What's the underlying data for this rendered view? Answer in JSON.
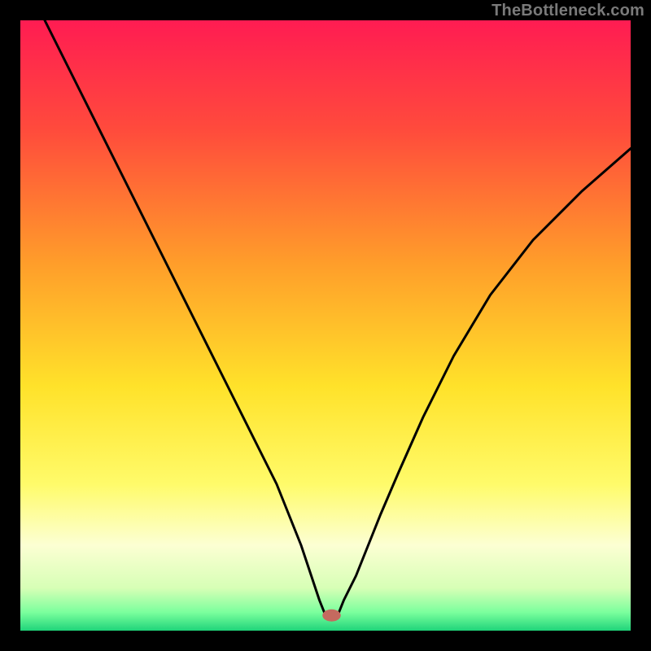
{
  "watermark": "TheBottleneck.com",
  "chart_data": {
    "type": "line",
    "title": "",
    "xlabel": "",
    "ylabel": "",
    "xlim": [
      0,
      100
    ],
    "ylim": [
      0,
      100
    ],
    "grid": false,
    "background_gradient_stops": [
      {
        "pct": 0,
        "color": "#ff1c52"
      },
      {
        "pct": 18,
        "color": "#ff4b3c"
      },
      {
        "pct": 40,
        "color": "#ff9e2a"
      },
      {
        "pct": 60,
        "color": "#ffe22a"
      },
      {
        "pct": 76,
        "color": "#fffb6a"
      },
      {
        "pct": 86,
        "color": "#fcffd3"
      },
      {
        "pct": 93,
        "color": "#d7ffb6"
      },
      {
        "pct": 97,
        "color": "#7bff9d"
      },
      {
        "pct": 100,
        "color": "#1fd47a"
      }
    ],
    "series": [
      {
        "name": "curve",
        "color": "#000000",
        "stroke_width": 3,
        "x": [
          4,
          10,
          16,
          22,
          28,
          33,
          36,
          39,
          42,
          44,
          46,
          47,
          48,
          49,
          50,
          51,
          52,
          53,
          55,
          57,
          59,
          62,
          66,
          71,
          77,
          84,
          92,
          100
        ],
        "y": [
          100,
          88,
          76,
          64,
          52,
          42,
          36,
          30,
          24,
          19,
          14,
          11,
          8,
          5,
          2.5,
          2.5,
          2.5,
          5,
          9,
          14,
          19,
          26,
          35,
          45,
          55,
          64,
          72,
          79
        ]
      }
    ],
    "marker": {
      "name": "min-point",
      "cx": 51,
      "cy": 2.5,
      "rx": 1.5,
      "ry": 1.0,
      "fill": "#c46a5f"
    }
  }
}
